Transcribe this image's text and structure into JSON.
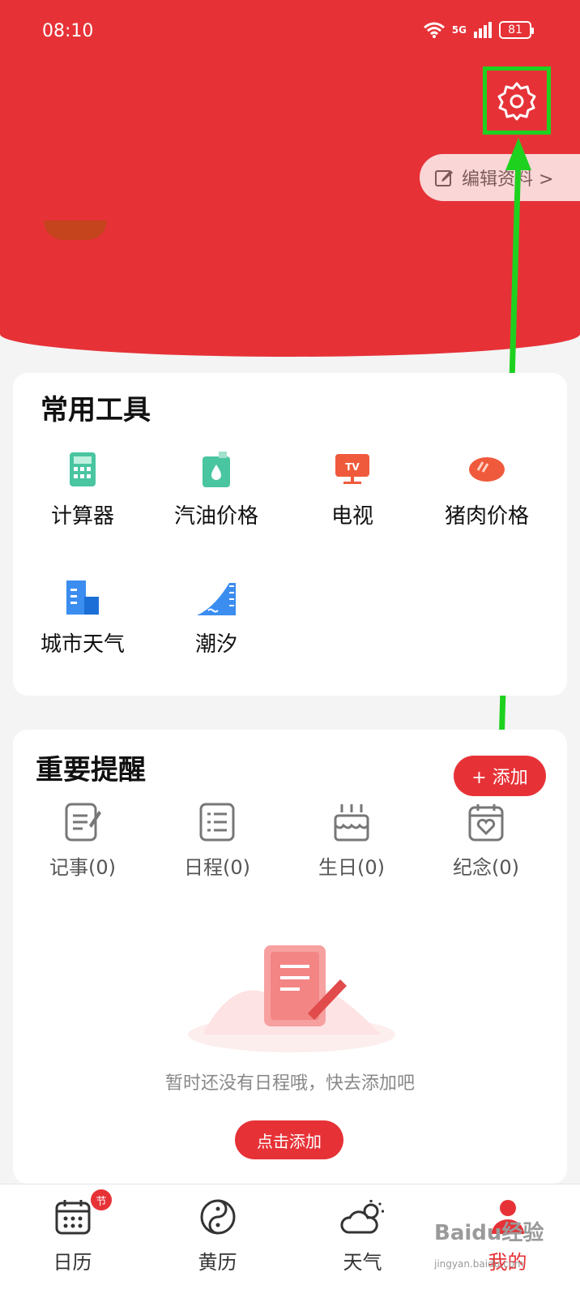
{
  "status_bar": {
    "time": "08:10",
    "network": "5G",
    "battery": "81"
  },
  "header": {
    "edit_profile_label": "编辑资料 >"
  },
  "tools": {
    "title": "常用工具",
    "items": [
      {
        "label": "计算器",
        "icon": "calculator-icon",
        "color": "#49c5a0"
      },
      {
        "label": "汽油价格",
        "icon": "gas-price-icon",
        "color": "#49c5a0"
      },
      {
        "label": "电视",
        "icon": "tv-icon",
        "color": "#f05a3c"
      },
      {
        "label": "猪肉价格",
        "icon": "pork-icon",
        "color": "#f05a3c"
      },
      {
        "label": "城市天气",
        "icon": "city-weather-icon",
        "color": "#3b8df0"
      },
      {
        "label": "潮汐",
        "icon": "tide-icon",
        "color": "#3b8df0"
      }
    ]
  },
  "reminders": {
    "title": "重要提醒",
    "add_button": "+ 添加",
    "items": [
      {
        "label": "记事(0)",
        "icon": "note-icon"
      },
      {
        "label": "日程(0)",
        "icon": "schedule-icon"
      },
      {
        "label": "生日(0)",
        "icon": "birthday-icon"
      },
      {
        "label": "纪念(0)",
        "icon": "anniversary-icon"
      }
    ],
    "empty_text": "暂时还没有日程哦，快去添加吧",
    "click_add_button": "点击添加"
  },
  "bottom_nav": {
    "items": [
      {
        "label": "日历",
        "icon": "calendar-icon",
        "badge": "节"
      },
      {
        "label": "黄历",
        "icon": "yin-yang-icon"
      },
      {
        "label": "天气",
        "icon": "weather-icon"
      },
      {
        "label": "我的",
        "icon": "profile-icon",
        "active": true
      }
    ]
  },
  "watermark": {
    "text": "Baidu经验",
    "url": "jingyan.baidu.com"
  },
  "colors": {
    "primary": "#e63237",
    "highlight": "#1fd11f"
  }
}
